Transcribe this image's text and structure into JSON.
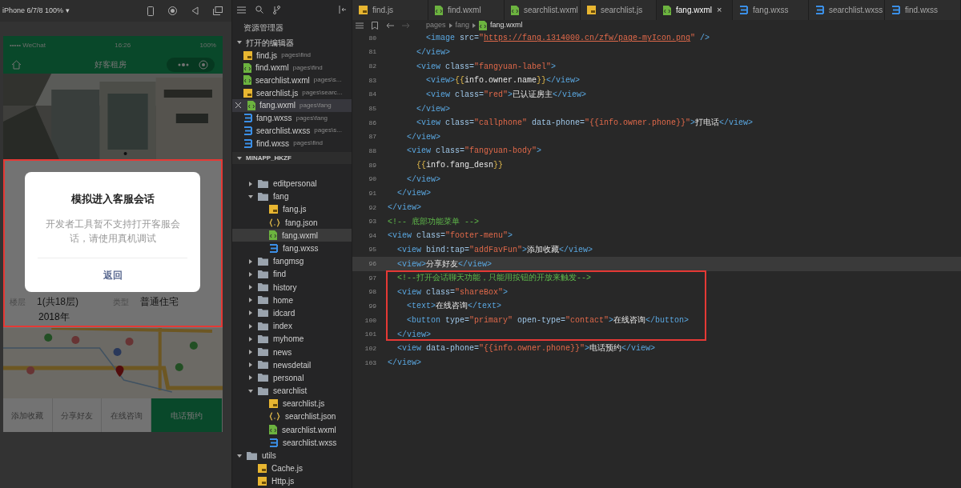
{
  "simulator": {
    "device": "iPhone 6/7/8 100% ▾",
    "status_bar": {
      "carrier": "••••• WeChat",
      "time": "16:26",
      "battery": "100%"
    },
    "nav_title": "好客租房",
    "details": [
      {
        "label": "楼层",
        "value": "1(共18层)"
      },
      {
        "label": "类型",
        "value": "普通住宅"
      }
    ],
    "year": "2018年",
    "footer": [
      {
        "label": "添加收藏",
        "primary": false
      },
      {
        "label": "分享好友",
        "primary": false
      },
      {
        "label": "在线咨询",
        "primary": false
      },
      {
        "label": "电话预约",
        "primary": true
      }
    ],
    "dialog": {
      "title": "模拟进入客服会话",
      "message": "开发者工具暂不支持打开客服会话，请使用真机调试",
      "button": "返回"
    }
  },
  "explorer": {
    "title": "资源管理器",
    "open_editors_title": "打开的编辑器",
    "open_editors": [
      {
        "name": "find.js",
        "path": "pages\\find",
        "kind": "js",
        "selected": false
      },
      {
        "name": "find.wxml",
        "path": "pages\\find",
        "kind": "wxml",
        "selected": false
      },
      {
        "name": "searchlist.wxml",
        "path": "pages\\s...",
        "kind": "wxml",
        "selected": false
      },
      {
        "name": "searchlist.js",
        "path": "pages\\searc...",
        "kind": "js",
        "selected": false
      },
      {
        "name": "fang.wxml",
        "path": "pages\\fang",
        "kind": "wxml",
        "selected": true
      },
      {
        "name": "fang.wxss",
        "path": "pages\\fang",
        "kind": "wxss",
        "selected": false
      },
      {
        "name": "searchlist.wxss",
        "path": "pages\\s...",
        "kind": "wxss",
        "selected": false
      },
      {
        "name": "find.wxss",
        "path": "pages\\find",
        "kind": "wxss",
        "selected": false
      }
    ],
    "project_title": "MINAPP_HKZF",
    "tree": [
      {
        "name": "editpersonal",
        "kind": "folder",
        "expanded": false
      },
      {
        "name": "fang",
        "kind": "folder",
        "expanded": true,
        "children": [
          {
            "name": "fang.js",
            "kind": "js",
            "selected": false
          },
          {
            "name": "fang.json",
            "kind": "json",
            "selected": false
          },
          {
            "name": "fang.wxml",
            "kind": "wxml",
            "selected": true
          },
          {
            "name": "fang.wxss",
            "kind": "wxss",
            "selected": false
          }
        ]
      },
      {
        "name": "fangmsg",
        "kind": "folder",
        "expanded": false
      },
      {
        "name": "find",
        "kind": "folder",
        "expanded": false
      },
      {
        "name": "history",
        "kind": "folder",
        "expanded": false
      },
      {
        "name": "home",
        "kind": "folder",
        "expanded": false
      },
      {
        "name": "idcard",
        "kind": "folder",
        "expanded": false
      },
      {
        "name": "index",
        "kind": "folder",
        "expanded": false
      },
      {
        "name": "myhome",
        "kind": "folder",
        "expanded": false
      },
      {
        "name": "news",
        "kind": "folder",
        "expanded": false
      },
      {
        "name": "newsdetail",
        "kind": "folder",
        "expanded": false
      },
      {
        "name": "personal",
        "kind": "folder",
        "expanded": false
      },
      {
        "name": "searchlist",
        "kind": "folder",
        "expanded": true,
        "children": [
          {
            "name": "searchlist.js",
            "kind": "js",
            "selected": false
          },
          {
            "name": "searchlist.json",
            "kind": "json",
            "selected": false
          },
          {
            "name": "searchlist.wxml",
            "kind": "wxml",
            "selected": false
          },
          {
            "name": "searchlist.wxss",
            "kind": "wxss",
            "selected": false
          }
        ]
      }
    ],
    "root_tree": [
      {
        "name": "utils",
        "kind": "folder",
        "expanded": true,
        "children": [
          {
            "name": "Cache.js",
            "kind": "js",
            "selected": false
          },
          {
            "name": "Http.js",
            "kind": "js",
            "selected": false
          }
        ]
      }
    ]
  },
  "editor": {
    "tabs": [
      {
        "name": "find.js",
        "kind": "js",
        "selected": false
      },
      {
        "name": "find.wxml",
        "kind": "wxml",
        "selected": false
      },
      {
        "name": "searchlist.wxml",
        "kind": "wxml",
        "selected": false
      },
      {
        "name": "searchlist.js",
        "kind": "js",
        "selected": false
      },
      {
        "name": "fang.wxml",
        "kind": "wxml",
        "selected": true,
        "close": "×"
      },
      {
        "name": "fang.wxss",
        "kind": "wxss",
        "selected": false
      },
      {
        "name": "searchlist.wxss",
        "kind": "wxss",
        "selected": false
      },
      {
        "name": "find.wxss",
        "kind": "wxss",
        "selected": false
      }
    ],
    "breadcrumb": [
      "pages",
      "fang",
      "fang.wxml"
    ],
    "lines": [
      {
        "number": "80",
        "highlighted": false,
        "segments": [
          {
            "kind": "tag",
            "text": "        <image "
          },
          {
            "kind": "attr",
            "text": "src="
          },
          {
            "kind": "string",
            "text": "\""
          },
          {
            "kind": "link",
            "text": "https://fang.1314000.cn/zfw/page-myIcon.png"
          },
          {
            "kind": "string",
            "text": "\""
          },
          {
            "kind": "tag",
            "text": " />"
          }
        ]
      },
      {
        "number": "81",
        "highlighted": false,
        "segments": [
          {
            "kind": "tag",
            "text": "      </view>"
          }
        ]
      },
      {
        "number": "82",
        "highlighted": false,
        "segments": [
          {
            "kind": "tag",
            "text": "      <view "
          },
          {
            "kind": "attr",
            "text": "class="
          },
          {
            "kind": "string",
            "text": "\"fangyuan-label\""
          },
          {
            "kind": "tag",
            "text": ">"
          }
        ]
      },
      {
        "number": "83",
        "highlighted": false,
        "segments": [
          {
            "kind": "tag",
            "text": "        <view>"
          },
          {
            "kind": "brace",
            "text": "{{"
          },
          {
            "kind": "text",
            "text": "info.owner.name"
          },
          {
            "kind": "brace",
            "text": "}}"
          },
          {
            "kind": "tag",
            "text": "</view>"
          }
        ]
      },
      {
        "number": "84",
        "highlighted": false,
        "segments": [
          {
            "kind": "tag",
            "text": "        <view "
          },
          {
            "kind": "attr",
            "text": "class="
          },
          {
            "kind": "string",
            "text": "\"red\""
          },
          {
            "kind": "tag",
            "text": ">"
          },
          {
            "kind": "text",
            "text": "已认证房主"
          },
          {
            "kind": "tag",
            "text": "</view>"
          }
        ]
      },
      {
        "number": "85",
        "highlighted": false,
        "segments": [
          {
            "kind": "tag",
            "text": "      </view>"
          }
        ]
      },
      {
        "number": "86",
        "highlighted": false,
        "segments": [
          {
            "kind": "tag",
            "text": "      <view "
          },
          {
            "kind": "attr",
            "text": "class="
          },
          {
            "kind": "string",
            "text": "\"callphone\""
          },
          {
            "kind": "attr",
            "text": " data-phone="
          },
          {
            "kind": "string",
            "text": "\"{{info.owner.phone}}\""
          },
          {
            "kind": "tag",
            "text": ">"
          },
          {
            "kind": "text",
            "text": "打电话"
          },
          {
            "kind": "tag",
            "text": "</view>"
          }
        ]
      },
      {
        "number": "87",
        "highlighted": false,
        "segments": [
          {
            "kind": "tag",
            "text": "    </view>"
          }
        ]
      },
      {
        "number": "88",
        "highlighted": false,
        "segments": [
          {
            "kind": "tag",
            "text": "    <view "
          },
          {
            "kind": "attr",
            "text": "class="
          },
          {
            "kind": "string",
            "text": "\"fangyuan-body\""
          },
          {
            "kind": "tag",
            "text": ">"
          }
        ]
      },
      {
        "number": "89",
        "highlighted": false,
        "segments": [
          {
            "kind": "brace",
            "text": "      {{"
          },
          {
            "kind": "text",
            "text": "info.fang_desn"
          },
          {
            "kind": "brace",
            "text": "}}"
          }
        ]
      },
      {
        "number": "90",
        "highlighted": false,
        "segments": [
          {
            "kind": "tag",
            "text": "    </view>"
          }
        ]
      },
      {
        "number": "91",
        "highlighted": false,
        "segments": [
          {
            "kind": "tag",
            "text": "  </view>"
          }
        ]
      },
      {
        "number": "92",
        "highlighted": false,
        "segments": [
          {
            "kind": "tag",
            "text": "</view>"
          }
        ]
      },
      {
        "number": "93",
        "highlighted": false,
        "segments": [
          {
            "kind": "comment",
            "text": "<!-- 底部功能菜单 -->"
          }
        ]
      },
      {
        "number": "94",
        "highlighted": false,
        "segments": [
          {
            "kind": "tag",
            "text": "<view "
          },
          {
            "kind": "attr",
            "text": "class="
          },
          {
            "kind": "string",
            "text": "\"footer-menu\""
          },
          {
            "kind": "tag",
            "text": ">"
          }
        ]
      },
      {
        "number": "95",
        "highlighted": false,
        "segments": [
          {
            "kind": "tag",
            "text": "  <view "
          },
          {
            "kind": "attr",
            "text": "bind:tap="
          },
          {
            "kind": "string",
            "text": "\"addFavFun\""
          },
          {
            "kind": "tag",
            "text": ">"
          },
          {
            "kind": "text",
            "text": "添加收藏"
          },
          {
            "kind": "tag",
            "text": "</view>"
          }
        ]
      },
      {
        "number": "96",
        "highlighted": true,
        "segments": [
          {
            "kind": "tag",
            "text": "  <view>"
          },
          {
            "kind": "text",
            "text": "分享好友"
          },
          {
            "kind": "tag",
            "text": "</view>"
          }
        ]
      },
      {
        "number": "97",
        "highlighted": false,
        "segments": [
          {
            "kind": "comment",
            "text": "  <!--打开会话聊天功能，只能用按钮的开放来触发-->"
          }
        ]
      },
      {
        "number": "98",
        "highlighted": false,
        "segments": [
          {
            "kind": "tag",
            "text": "  <view "
          },
          {
            "kind": "attr",
            "text": "class="
          },
          {
            "kind": "string",
            "text": "\"shareBox\""
          },
          {
            "kind": "tag",
            "text": ">"
          }
        ]
      },
      {
        "number": "99",
        "highlighted": false,
        "segments": [
          {
            "kind": "tag",
            "text": "    <text>"
          },
          {
            "kind": "text",
            "text": "在线咨询"
          },
          {
            "kind": "tag",
            "text": "</text>"
          }
        ]
      },
      {
        "number": "100",
        "highlighted": false,
        "segments": [
          {
            "kind": "tag",
            "text": "    <button "
          },
          {
            "kind": "attr",
            "text": "type="
          },
          {
            "kind": "string",
            "text": "\"primary\""
          },
          {
            "kind": "attr",
            "text": " open-type="
          },
          {
            "kind": "string",
            "text": "\"contact\""
          },
          {
            "kind": "tag",
            "text": ">"
          },
          {
            "kind": "text",
            "text": "在线咨询"
          },
          {
            "kind": "tag",
            "text": "</button>"
          }
        ]
      },
      {
        "number": "101",
        "highlighted": false,
        "segments": [
          {
            "kind": "tag",
            "text": "  </view>"
          }
        ]
      },
      {
        "number": "102",
        "highlighted": false,
        "segments": [
          {
            "kind": "tag",
            "text": "  <view "
          },
          {
            "kind": "attr",
            "text": "data-phone="
          },
          {
            "kind": "string",
            "text": "\"{{info.owner.phone}}\""
          },
          {
            "kind": "tag",
            "text": ">"
          },
          {
            "kind": "text",
            "text": "电话预约"
          },
          {
            "kind": "tag",
            "text": "</view>"
          }
        ]
      },
      {
        "number": "103",
        "highlighted": false,
        "segments": [
          {
            "kind": "tag",
            "text": "</view>"
          }
        ]
      }
    ]
  }
}
